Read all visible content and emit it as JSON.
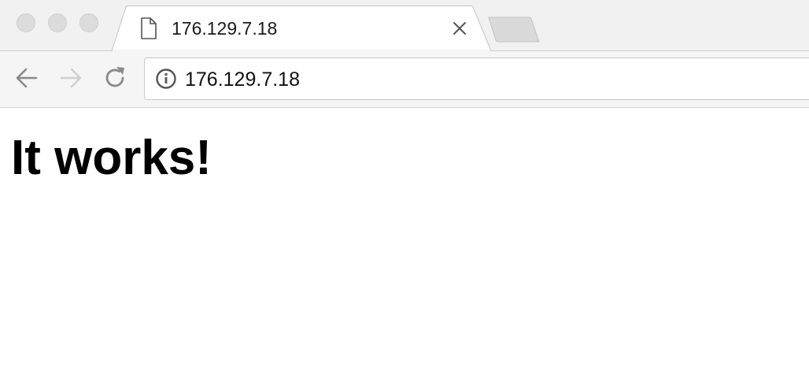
{
  "tab": {
    "title": "176.129.7.18",
    "icon": "document-icon",
    "close_icon": "close-icon"
  },
  "toolbar": {
    "back_icon": "arrow-left-icon",
    "forward_icon": "arrow-right-icon",
    "reload_icon": "reload-icon",
    "security_icon": "info-icon",
    "url": "176.129.7.18"
  },
  "page": {
    "heading": "It works!"
  },
  "colors": {
    "tabstrip_bg": "#f1f1f1",
    "toolbar_bg": "#f5f5f5",
    "icon_active": "#8a8a8a",
    "icon_disabled": "#d0d0d0"
  }
}
